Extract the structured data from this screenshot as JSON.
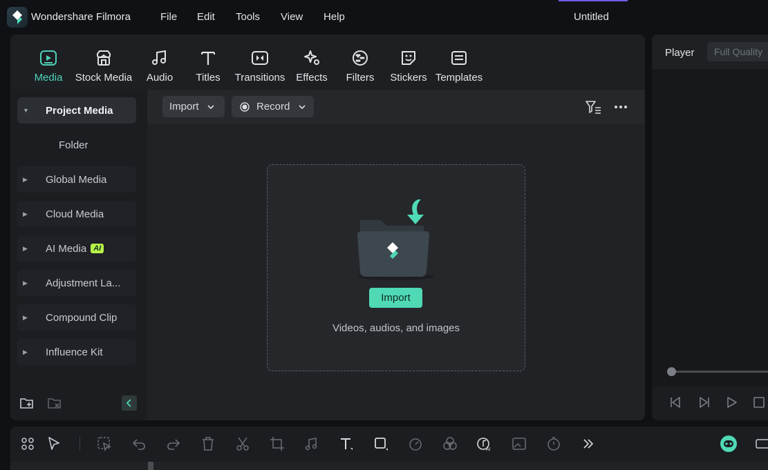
{
  "app": {
    "name": "Wondershare Filmora",
    "document_title": "Untitled"
  },
  "menu": [
    "File",
    "Edit",
    "Tools",
    "View",
    "Help"
  ],
  "tabs": [
    {
      "label": "Media",
      "icon": "media-icon",
      "active": true
    },
    {
      "label": "Stock Media",
      "icon": "stock-media-icon"
    },
    {
      "label": "Audio",
      "icon": "audio-note-icon"
    },
    {
      "label": "Titles",
      "icon": "titles-t-icon"
    },
    {
      "label": "Transitions",
      "icon": "transitions-icon"
    },
    {
      "label": "Effects",
      "icon": "effects-sparkle-icon"
    },
    {
      "label": "Filters",
      "icon": "filters-icon"
    },
    {
      "label": "Stickers",
      "icon": "stickers-icon"
    },
    {
      "label": "Templates",
      "icon": "templates-icon"
    }
  ],
  "sidebar": {
    "items": [
      {
        "label": "Project Media",
        "expanded": true
      },
      {
        "label": "Folder"
      },
      {
        "label": "Global Media"
      },
      {
        "label": "Cloud Media"
      },
      {
        "label": "AI Media",
        "badge": "AI"
      },
      {
        "label": "Adjustment La..."
      },
      {
        "label": "Compound Clip"
      },
      {
        "label": "Influence Kit"
      }
    ]
  },
  "media_toolbar": {
    "import_label": "Import",
    "record_label": "Record"
  },
  "drop_zone": {
    "button_label": "Import",
    "hint": "Videos, audios, and images"
  },
  "player": {
    "label": "Player",
    "quality": "Full Quality"
  },
  "colors": {
    "accent": "#4fd9b5",
    "active_tab": "#4fd2b7",
    "ai_badge": "#b7f24a",
    "title_accent": "#6c5ce7"
  }
}
